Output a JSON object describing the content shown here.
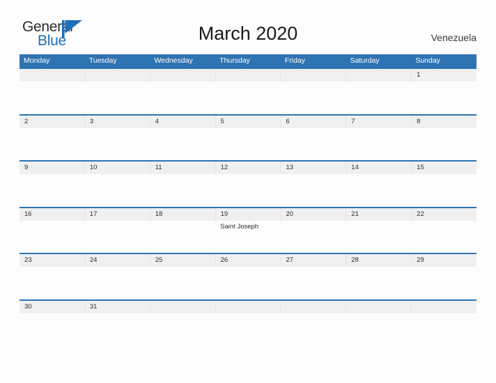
{
  "brand": {
    "name_part1": "General",
    "name_part2": "Blue",
    "flag_icon": "flag-icon",
    "accent_color": "#1f6fb8"
  },
  "header": {
    "title": "March 2020",
    "country": "Venezuela"
  },
  "theme": {
    "header_blue": "#2e73b2",
    "row_border_blue": "#2e73b2",
    "day_band_gray": "#f0f0f0",
    "page_background": "#fdfdfd",
    "text_dark": "#2a2a2a"
  },
  "calendar": {
    "weekdays": [
      "Monday",
      "Tuesday",
      "Wednesday",
      "Thursday",
      "Friday",
      "Saturday",
      "Sunday"
    ],
    "weeks": [
      [
        {
          "date": "",
          "event": ""
        },
        {
          "date": "",
          "event": ""
        },
        {
          "date": "",
          "event": ""
        },
        {
          "date": "",
          "event": ""
        },
        {
          "date": "",
          "event": ""
        },
        {
          "date": "",
          "event": ""
        },
        {
          "date": "1",
          "event": ""
        }
      ],
      [
        {
          "date": "2",
          "event": ""
        },
        {
          "date": "3",
          "event": ""
        },
        {
          "date": "4",
          "event": ""
        },
        {
          "date": "5",
          "event": ""
        },
        {
          "date": "6",
          "event": ""
        },
        {
          "date": "7",
          "event": ""
        },
        {
          "date": "8",
          "event": ""
        }
      ],
      [
        {
          "date": "9",
          "event": ""
        },
        {
          "date": "10",
          "event": ""
        },
        {
          "date": "11",
          "event": ""
        },
        {
          "date": "12",
          "event": ""
        },
        {
          "date": "13",
          "event": ""
        },
        {
          "date": "14",
          "event": ""
        },
        {
          "date": "15",
          "event": ""
        }
      ],
      [
        {
          "date": "16",
          "event": ""
        },
        {
          "date": "17",
          "event": ""
        },
        {
          "date": "18",
          "event": ""
        },
        {
          "date": "19",
          "event": "Saint Joseph"
        },
        {
          "date": "20",
          "event": ""
        },
        {
          "date": "21",
          "event": ""
        },
        {
          "date": "22",
          "event": ""
        }
      ],
      [
        {
          "date": "23",
          "event": ""
        },
        {
          "date": "24",
          "event": ""
        },
        {
          "date": "25",
          "event": ""
        },
        {
          "date": "26",
          "event": ""
        },
        {
          "date": "27",
          "event": ""
        },
        {
          "date": "28",
          "event": ""
        },
        {
          "date": "29",
          "event": ""
        }
      ],
      [
        {
          "date": "30",
          "event": ""
        },
        {
          "date": "31",
          "event": ""
        },
        {
          "date": "",
          "event": ""
        },
        {
          "date": "",
          "event": ""
        },
        {
          "date": "",
          "event": ""
        },
        {
          "date": "",
          "event": ""
        },
        {
          "date": "",
          "event": ""
        }
      ]
    ]
  }
}
